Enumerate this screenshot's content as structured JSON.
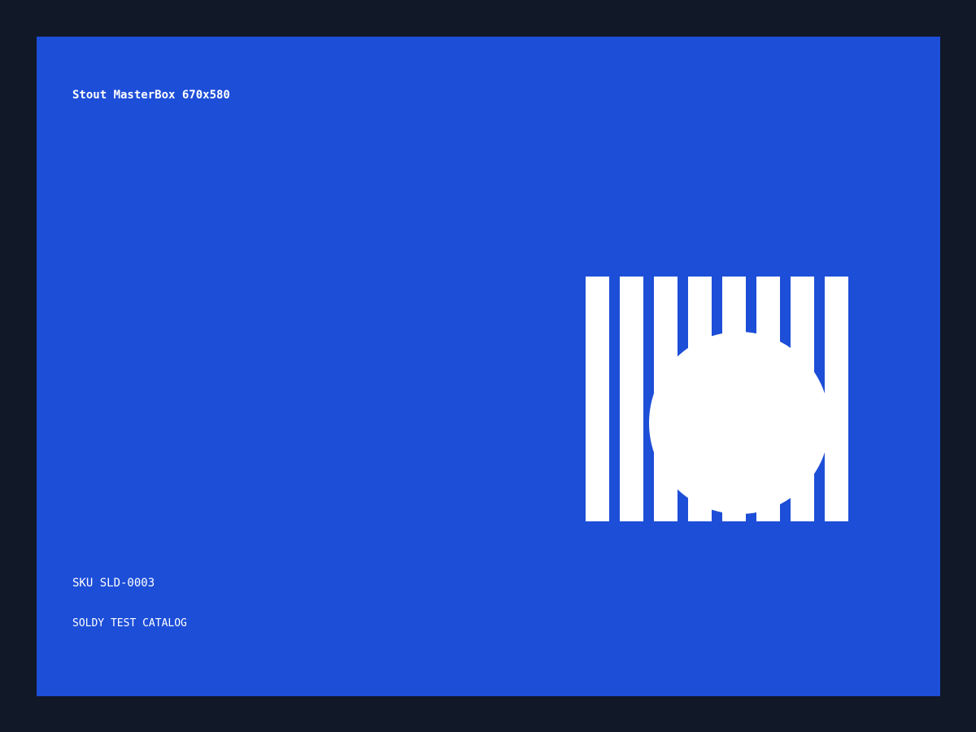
{
  "product": {
    "title": "Stout MasterBox 670x580",
    "sku": "SKU SLD-0003",
    "catalog": "SOLDY TEST CATALOG"
  },
  "graphic": {
    "stripe_count": 8,
    "stripe_icon": "barcode-stripes-icon",
    "circle_icon": "circle-icon"
  },
  "colors": {
    "page_background": "#111827",
    "panel_background": "#1d4ed8",
    "foreground": "#ffffff"
  }
}
